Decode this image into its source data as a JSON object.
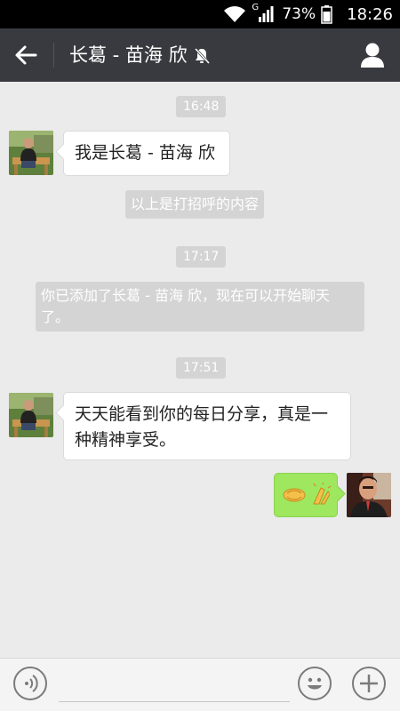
{
  "status_bar": {
    "network_label": "G",
    "battery_percent": "73%",
    "time": "18:26",
    "icons": [
      "wifi-icon",
      "signal-icon",
      "battery-icon"
    ]
  },
  "header": {
    "title": "长葛 - 苗海 欣",
    "icons": [
      "back-arrow-icon",
      "mute-bell-icon",
      "profile-icon"
    ]
  },
  "messages": [
    {
      "type": "time",
      "text": "16:48"
    },
    {
      "type": "incoming",
      "text": "我是长葛 - 苗海 欣"
    },
    {
      "type": "system",
      "text": "以上是打招呼的内容"
    },
    {
      "type": "time",
      "text": "17:17"
    },
    {
      "type": "system",
      "text_line1": "你已添加了长葛 - 苗海 欣，现在可以开始聊天",
      "text_line2": "了。"
    },
    {
      "type": "time",
      "text": "17:51"
    },
    {
      "type": "incoming",
      "text_line1": "天天能看到你的每日分享，真是一",
      "text_line2": "种精神享受。"
    },
    {
      "type": "outgoing",
      "content": "handshake and clapping emoji"
    }
  ],
  "input_bar": {
    "icons": [
      "voice-icon",
      "emoji-icon",
      "plus-icon"
    ]
  },
  "colors": {
    "header_bg": "#393a3f",
    "chat_bg": "#ebebeb",
    "outgoing_bubble": "#9ee75f",
    "incoming_bubble": "#ffffff"
  }
}
